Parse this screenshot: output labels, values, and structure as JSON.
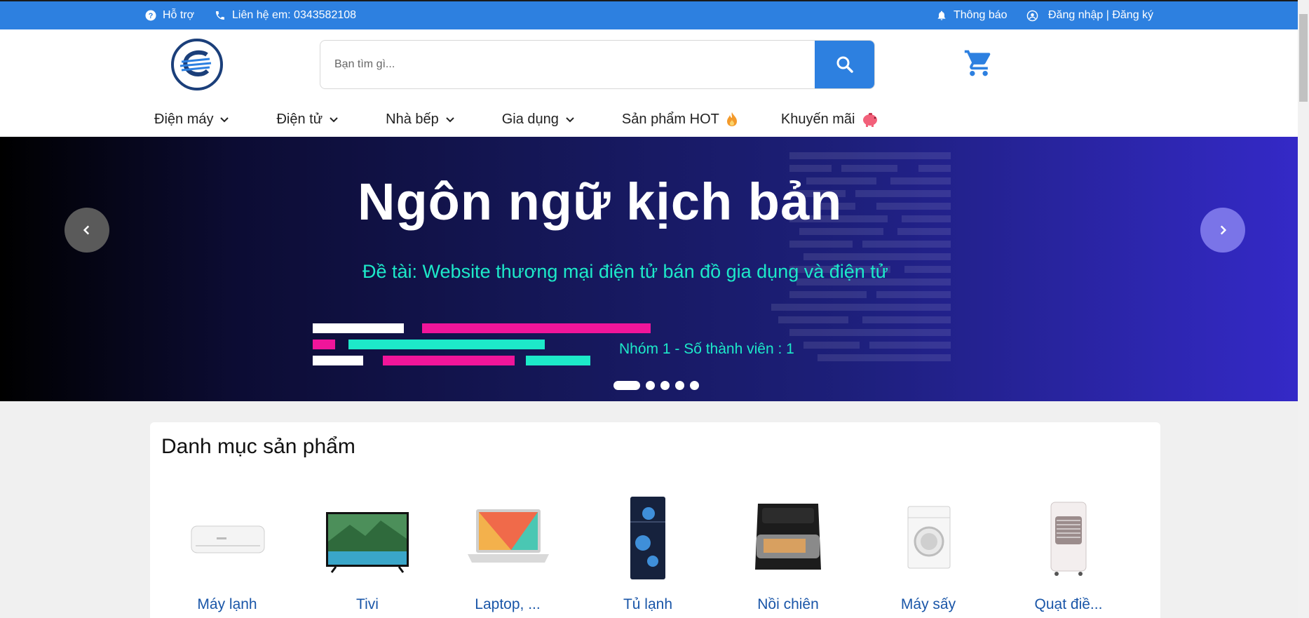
{
  "topbar": {
    "support": "Hỗ trợ",
    "contact": "Liên hệ em: 0343582108",
    "notifications": "Thông báo",
    "auth": "Đăng nhập | Đăng ký"
  },
  "search": {
    "placeholder": "Bạn tìm gì..."
  },
  "nav": [
    {
      "label": "Điện máy"
    },
    {
      "label": "Điện tử"
    },
    {
      "label": "Nhà bếp"
    },
    {
      "label": "Gia dụng"
    },
    {
      "label": "Sản phẩm HOT"
    },
    {
      "label": "Khuyến mãi"
    }
  ],
  "banner": {
    "title": "Ngôn ngữ kịch bản",
    "subtitle": "Đề tài: Website thương mại điện tử bán đồ gia dụng và điện tử",
    "group": "Nhóm 1 - Số thành viên : 1",
    "slide_count": 5,
    "active_slide": 1
  },
  "categories": {
    "title": "Danh mục sản phẩm",
    "items": [
      {
        "label": "Máy lạnh"
      },
      {
        "label": "Tivi"
      },
      {
        "label": "Laptop, ..."
      },
      {
        "label": "Tủ lạnh"
      },
      {
        "label": "Nồi chiên"
      },
      {
        "label": "Máy sấy"
      },
      {
        "label": "Quạt điề..."
      }
    ]
  },
  "colors": {
    "primary": "#2d80e0",
    "accent_teal": "#1de9c9",
    "accent_pink": "#f0159a",
    "category_text": "#1a56a8"
  }
}
